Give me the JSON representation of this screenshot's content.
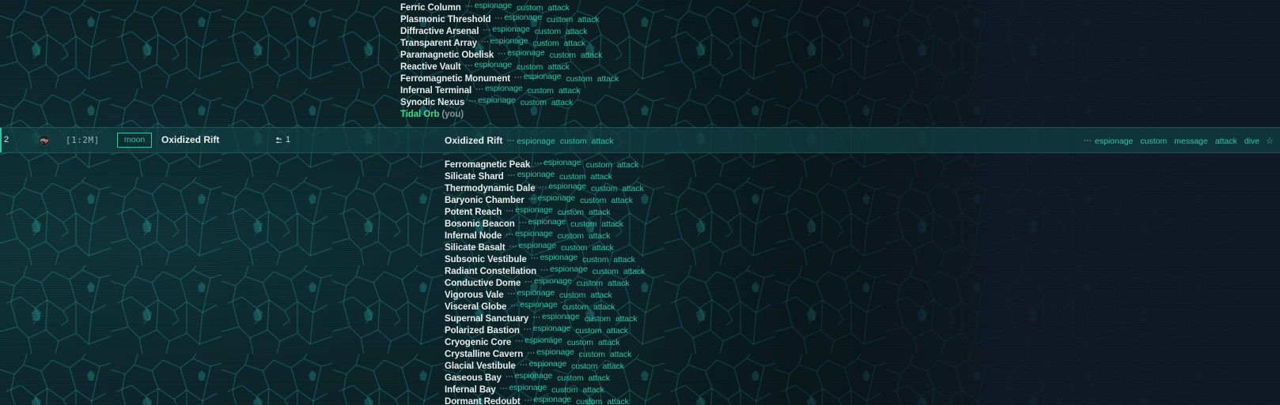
{
  "top_list": [
    {
      "name": "Ferric Column"
    },
    {
      "name": "Plasmonic Threshold"
    },
    {
      "name": "Diffractive Arsenal"
    },
    {
      "name": "Transparent Array"
    },
    {
      "name": "Paramagnetic Obelisk"
    },
    {
      "name": "Reactive Vault"
    },
    {
      "name": "Ferromagnetic Monument"
    },
    {
      "name": "Infernal Terminal"
    },
    {
      "name": "Synodic Nexus"
    }
  ],
  "self_entry": {
    "name": "Tidal Orb",
    "suffix": "(you)"
  },
  "actions": {
    "dots": "⋯",
    "espionage": "espionage",
    "custom": "custom",
    "attack": "attack",
    "message": "message",
    "dive": "dive",
    "star": "☆"
  },
  "planet_row": {
    "rank": "2",
    "coords": "[1:2M]",
    "moon_label": "moon",
    "planet_name": "Oxidized Rift",
    "ally_count": "1",
    "player_name": "Oxidized Rift"
  },
  "bottom_list": [
    {
      "name": "Ferromagnetic Peak"
    },
    {
      "name": "Silicate Shard"
    },
    {
      "name": "Thermodynamic Dale"
    },
    {
      "name": "Baryonic Chamber"
    },
    {
      "name": "Potent Reach"
    },
    {
      "name": "Bosonic Beacon"
    },
    {
      "name": "Infernal Node"
    },
    {
      "name": "Silicate Basalt"
    },
    {
      "name": "Subsonic Vestibule"
    },
    {
      "name": "Radiant Constellation"
    },
    {
      "name": "Conductive Dome"
    },
    {
      "name": "Vigorous Vale"
    },
    {
      "name": "Visceral Globe"
    },
    {
      "name": "Supernal Sanctuary"
    },
    {
      "name": "Polarized Bastion"
    },
    {
      "name": "Cryogenic Core"
    },
    {
      "name": "Crystalline Cavern"
    },
    {
      "name": "Glacial Vestibule"
    },
    {
      "name": "Gaseous Bay"
    },
    {
      "name": "Infernal Bay"
    },
    {
      "name": "Dormant Redoubt"
    }
  ],
  "colors": {
    "accent": "#2fc6a6",
    "self_highlight": "#3fdc92",
    "text": "#e8eeee",
    "background": "#0c1e22"
  }
}
